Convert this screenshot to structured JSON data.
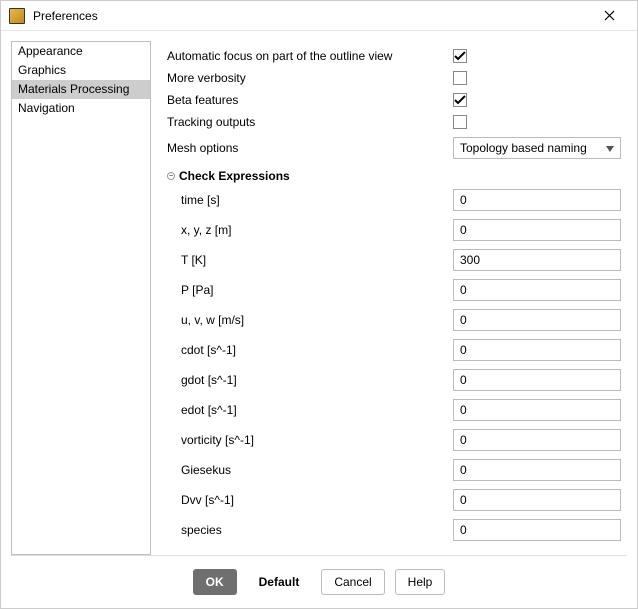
{
  "window": {
    "title": "Preferences"
  },
  "sidebar": {
    "items": [
      {
        "label": "Appearance",
        "selected": false
      },
      {
        "label": "Graphics",
        "selected": false
      },
      {
        "label": "Materials Processing",
        "selected": true
      },
      {
        "label": "Navigation",
        "selected": false
      }
    ]
  },
  "settings": {
    "auto_focus": {
      "label": "Automatic focus on part of the outline view",
      "checked": true
    },
    "verbosity": {
      "label": "More verbosity",
      "checked": false
    },
    "beta": {
      "label": "Beta features",
      "checked": true
    },
    "tracking": {
      "label": "Tracking outputs",
      "checked": false
    },
    "mesh": {
      "label": "Mesh options",
      "value": "Topology based naming"
    }
  },
  "check_expr": {
    "header": "Check Expressions",
    "rows": [
      {
        "label": "time [s]",
        "value": "0"
      },
      {
        "label": "x, y, z [m]",
        "value": "0"
      },
      {
        "label": "T [K]",
        "value": "300"
      },
      {
        "label": "P [Pa]",
        "value": "0"
      },
      {
        "label": "u, v, w [m/s]",
        "value": "0"
      },
      {
        "label": "cdot [s^-1]",
        "value": "0"
      },
      {
        "label": "gdot [s^-1]",
        "value": "0"
      },
      {
        "label": "edot [s^-1]",
        "value": "0"
      },
      {
        "label": "vorticity [s^-1]",
        "value": "0"
      },
      {
        "label": "Giesekus",
        "value": "0"
      },
      {
        "label": "Dvv [s^-1]",
        "value": "0"
      },
      {
        "label": "species",
        "value": "0"
      }
    ]
  },
  "buttons": {
    "ok": "OK",
    "default": "Default",
    "cancel": "Cancel",
    "help": "Help"
  }
}
